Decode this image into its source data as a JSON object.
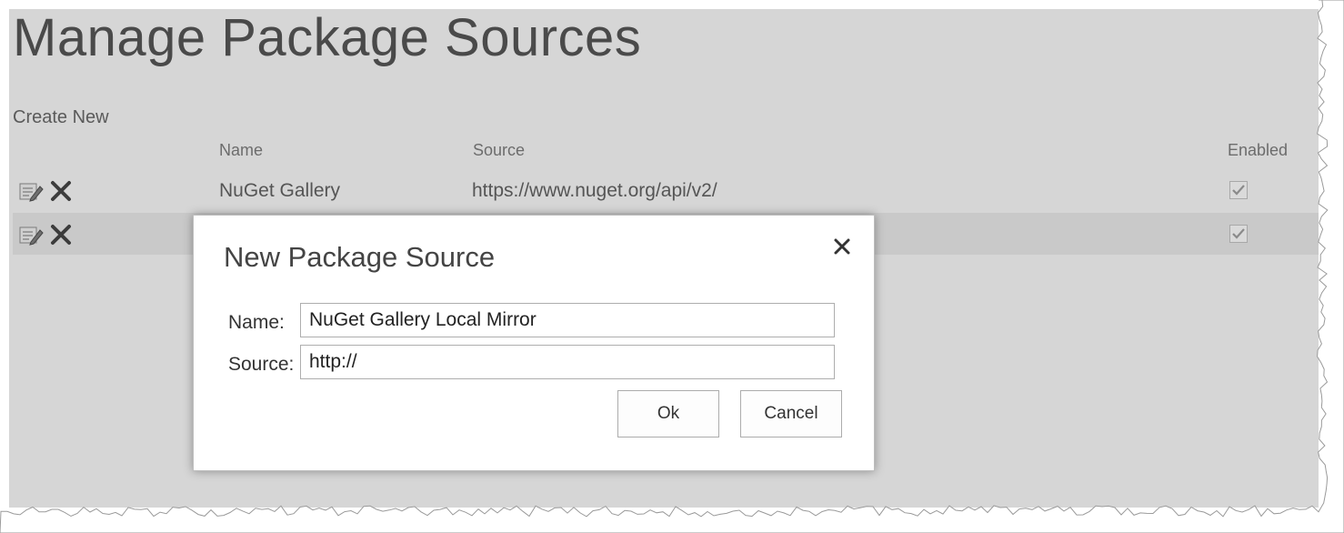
{
  "page": {
    "title": "Manage Package Sources",
    "create_new_label": "Create New"
  },
  "table": {
    "columns": {
      "name": "Name",
      "source": "Source",
      "enabled": "Enabled"
    },
    "rows": [
      {
        "name": "NuGet Gallery",
        "source": "https://www.nuget.org/api/v2/",
        "enabled": true,
        "edit_icon": "edit-icon",
        "delete_icon": "delete-icon"
      },
      {
        "name": "",
        "source": "",
        "enabled": true,
        "edit_icon": "edit-icon",
        "delete_icon": "delete-icon"
      }
    ]
  },
  "dialog": {
    "title": "New Package Source",
    "close_icon": "close-icon",
    "name_label": "Name:",
    "name_value": "NuGet Gallery Local Mirror",
    "source_label": "Source:",
    "source_value": "http://",
    "ok_label": "Ok",
    "cancel_label": "Cancel"
  },
  "colors": {
    "page_background": "#d6d6d6",
    "alt_row": "#c9c9c9",
    "dialog_background": "#ffffff"
  }
}
